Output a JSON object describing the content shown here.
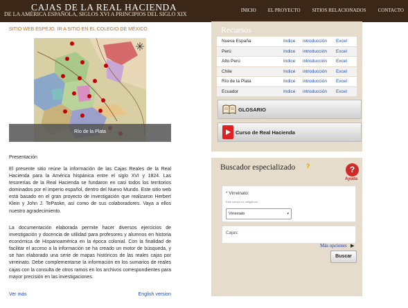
{
  "header": {
    "title": "CAJAS DE LA REAL HACIENDA",
    "subtitle": "DE LA AMÉRICA ESPAÑOLA, SIGLOS XVI A PRINCIPIOS DEL SIGLO XIX",
    "nav": [
      "INICIO",
      "EL PROYECTO",
      "SITIOS RELACIONADOS",
      "CONTACTO"
    ]
  },
  "mirror": {
    "prefix": "SITIO WEB ESPEJO.",
    "link": "IR A SITIO EN EL COLEGIO DE MÉXICO"
  },
  "map": {
    "caption": "Río de la Plata"
  },
  "presentation": {
    "heading": "Presentación",
    "p1": "El presente sitio reúne la información de las Cajas Reales de la Real Hacienda para la América hispánica entre el siglo XVI y 1824. Las tesorerías de la Real Hacienda se fundaron en casi todos los territorios dominados por el imperio español, dentro del Nuevo Mundo. Este sitio web está basado en el gran proyecto de investigación que realizaron Herbert Klein y John J. TePaske, así como de sus colaboradores. Vaya a ellos nuestro agradecimiento.",
    "p2": "La documentación elaborada permite hacer diversos ejercicios de investigación y docencia de utilidad para profesores y alumnos en historia económica de Hispanoamérica en la época colonial. Con la finalidad de facilitar el acceso a la información se ha creado un motor de búsqueda, y se han elaborado una serie de mapas históricos de las reales cajas por virreinato. Debe complementarse la información en los sumarios de reales cajas con la consulta de otros ramos en los archivos correspondientes para mayor precisión en las investigaciones.",
    "ver_mas": "Ver más",
    "english": "English version"
  },
  "recursos": {
    "title": "Recursos",
    "rows": [
      {
        "name": "Nueva España",
        "indice": "Indice",
        "intro": "introducción",
        "excel": "Excel"
      },
      {
        "name": "Perú",
        "indice": "Indice",
        "intro": "introducción",
        "excel": "Excel"
      },
      {
        "name": "Alto Perú",
        "indice": "Indice",
        "intro": "introducción",
        "excel": "Excel"
      },
      {
        "name": "Chile",
        "indice": "Indice",
        "intro": "introducción",
        "excel": "Excel"
      },
      {
        "name": "Río de la Plata",
        "indice": "Indice",
        "intro": "introducción",
        "excel": "Excel"
      },
      {
        "name": "Ecuador",
        "indice": "Indice",
        "intro": "introducción",
        "excel": "Excel"
      }
    ],
    "glosario": "GLOSARIO",
    "curso": "Curso de Real Hacienda"
  },
  "search": {
    "title": "Buscador especializado",
    "q_mark": "?",
    "help_symbol": "?",
    "help_label": "Ayuda",
    "virreinato_label": "Virreinato:",
    "required_mark": "*",
    "help_text": "Este campo es obligatorio.",
    "select_value": "Virreinato",
    "select_arrow": "▾",
    "cajas_label": "Cajas:",
    "mas_opciones": "Más opciones",
    "mas_arrow": "▶",
    "buscar": "Buscar"
  },
  "colors": {
    "header_bg": "#3b2717",
    "panel_bg": "#e6dccb",
    "link": "#1f4fb4",
    "accent_orange": "#c46b1a",
    "help_red": "#d12929"
  }
}
